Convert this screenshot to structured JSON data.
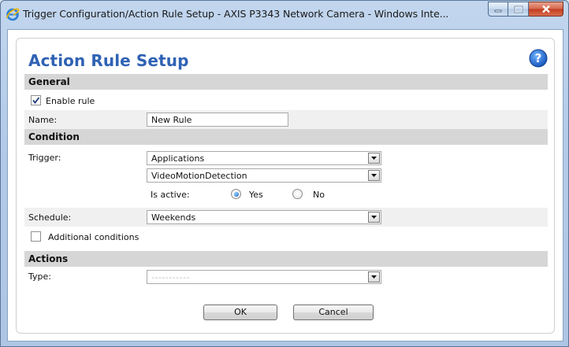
{
  "window": {
    "title": "Trigger Configuration/Action Rule Setup - AXIS P3343 Network Camera - Windows Inte..."
  },
  "page": {
    "title": "Action Rule Setup"
  },
  "general": {
    "header": "General",
    "enable_rule_label": "Enable rule",
    "enable_rule_checked": true,
    "name_label": "Name:",
    "name_value": "New Rule"
  },
  "condition": {
    "header": "Condition",
    "trigger_label": "Trigger:",
    "trigger_value": "Applications",
    "trigger_sub_value": "VideoMotionDetection",
    "is_active_label": "Is active:",
    "yes_label": "Yes",
    "no_label": "No",
    "is_active_selected": "Yes",
    "schedule_label": "Schedule:",
    "schedule_value": "Weekends",
    "additional_conditions_label": "Additional conditions",
    "additional_conditions_checked": false
  },
  "actions": {
    "header": "Actions",
    "type_label": "Type:",
    "type_value": "-----------"
  },
  "buttons": {
    "ok": "OK",
    "cancel": "Cancel"
  },
  "colors": {
    "title_blue": "#2f62b4",
    "section_gray": "#d6d6d6",
    "close_red": "#c23b1e"
  },
  "icons": {
    "browser": "internet-explorer-icon",
    "help": "help-icon",
    "minimize": "minimize-icon",
    "maximize": "maximize-icon",
    "close": "close-icon"
  }
}
